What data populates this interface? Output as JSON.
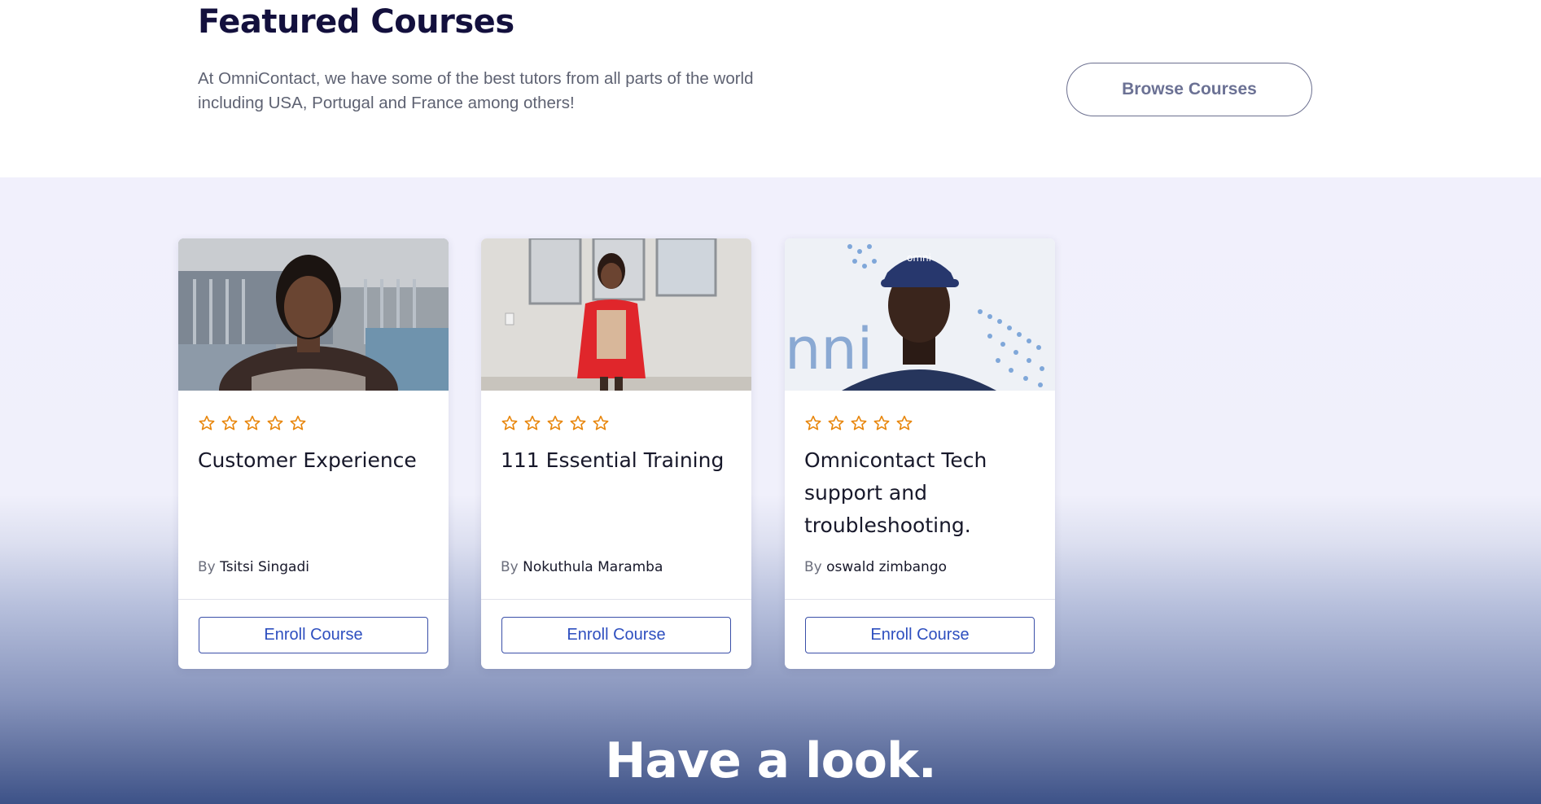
{
  "intro": {
    "title": "Featured Courses",
    "description": "At OmniContact, we have some of the best tutors from all parts of the world including USA, Portugal and France among others!",
    "browse_button": "Browse Courses"
  },
  "courses": [
    {
      "rating": 0,
      "rating_max": 5,
      "title": "Customer Experience",
      "by_label": "By",
      "author": "Tsitsi Singadi",
      "enroll_label": "Enroll Course"
    },
    {
      "rating": 0,
      "rating_max": 5,
      "title": "111 Essential Training",
      "by_label": "By",
      "author": "Nokuthula Maramba",
      "enroll_label": "Enroll Course"
    },
    {
      "rating": 0,
      "rating_max": 5,
      "title": "Omnicontact Tech support and troubleshooting.",
      "by_label": "By",
      "author": "oswald zimbango",
      "enroll_label": "Enroll Course"
    }
  ],
  "section2": {
    "title": "Have a look."
  },
  "colors": {
    "heading": "#13103d",
    "star": "#e8870e",
    "enroll": "#2e4fbf",
    "band_top": "#f1f0fc",
    "band_bottom": "#3d5288"
  }
}
